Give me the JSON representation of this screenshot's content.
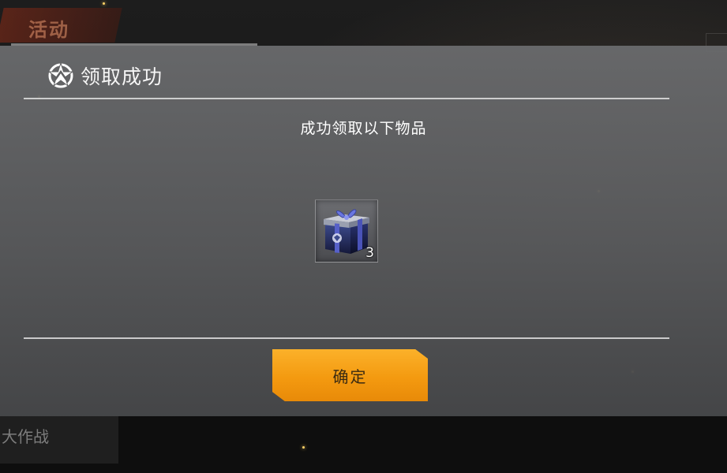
{
  "background": {
    "tab_label": "活动",
    "footer_label": "大作战"
  },
  "dialog": {
    "title": "领取成功",
    "title_icon": "star-emblem-icon",
    "subtitle": "成功领取以下物品",
    "items": [
      {
        "icon": "gift-box-icon",
        "count": "3"
      }
    ],
    "confirm_label": "确定"
  },
  "colors": {
    "accent": "#f49a10",
    "dialog_bg": "#5f6062",
    "text": "#ffffff"
  }
}
